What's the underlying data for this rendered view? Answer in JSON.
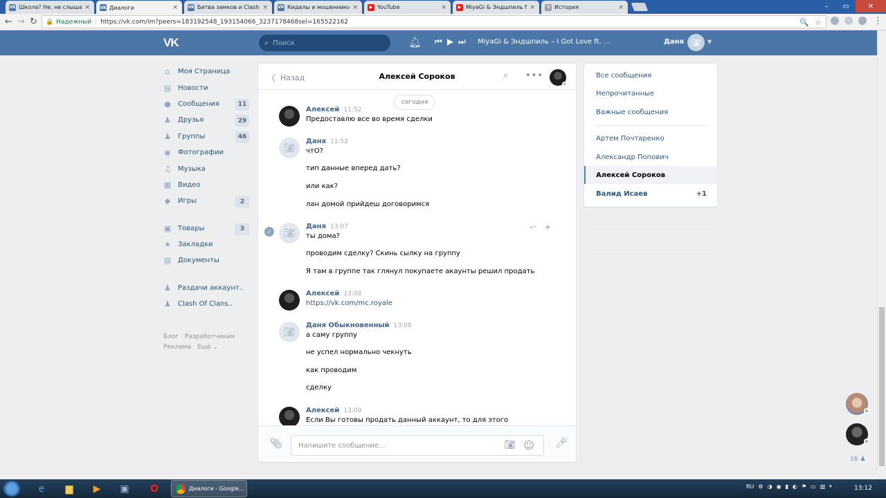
{
  "browser": {
    "tabs": [
      {
        "title": "Школа? Не, не слышали!",
        "fav": "VK",
        "color": "#4a76a8"
      },
      {
        "title": "Диалоги",
        "fav": "VK",
        "color": "#4a76a8"
      },
      {
        "title": "Битва замков и Clash Roya",
        "fav": "VK",
        "color": "#4a76a8"
      },
      {
        "title": "Кидалы и мошенники в vk",
        "fav": "VK",
        "color": "#4a76a8"
      },
      {
        "title": "YouTube",
        "fav": "▶",
        "color": "#e62117"
      },
      {
        "title": "MiyaGi & Эндшпиль ft. An",
        "fav": "▶",
        "color": "#e62117"
      },
      {
        "title": "История",
        "fav": "⟲",
        "color": "#9aa0a6"
      }
    ],
    "close_glyph": "×",
    "secure_label": "Надежный",
    "url": "https://vk.com/im?peers=183192548_193154066_3237178468sel=165522162"
  },
  "header": {
    "logo": "VK",
    "search_placeholder": "Поиск",
    "track": "MiyaGi & Эндшпиль – I Got Love ft. ...",
    "user_name": "Даня"
  },
  "left_menu": {
    "items": [
      {
        "label": "Моя Страница",
        "icon": "⌂",
        "count": ""
      },
      {
        "label": "Новости",
        "icon": "▤",
        "count": ""
      },
      {
        "label": "Сообщения",
        "icon": "●",
        "count": "11"
      },
      {
        "label": "Друзья",
        "icon": "♟",
        "count": "29"
      },
      {
        "label": "Группы",
        "icon": "♟",
        "count": "46"
      },
      {
        "label": "Фотографии",
        "icon": "◉",
        "count": ""
      },
      {
        "label": "Музыка",
        "icon": "♫",
        "count": ""
      },
      {
        "label": "Видео",
        "icon": "▦",
        "count": ""
      },
      {
        "label": "Игры",
        "icon": "◆",
        "count": "2"
      }
    ],
    "items2": [
      {
        "label": "Товары",
        "icon": "▣",
        "count": "3"
      },
      {
        "label": "Закладки",
        "icon": "★",
        "count": ""
      },
      {
        "label": "Документы",
        "icon": "▤",
        "count": ""
      }
    ],
    "items3": [
      {
        "label": "Раздачи аккаунт..",
        "icon": "♟",
        "count": ""
      },
      {
        "label": "Clash Of Clans..",
        "icon": "♟",
        "count": ""
      }
    ],
    "footer": [
      "Блог",
      "Разработчикам",
      "Реклама",
      "Ещё ⌄"
    ]
  },
  "chat": {
    "back_label": "Назад",
    "title": "Алексей Сороков",
    "date_pill": "сегодня",
    "messages": [
      {
        "author": "Алексей",
        "time": "11:52",
        "ava": "photo",
        "lines": [
          "Предоставлю все во время сделки"
        ]
      },
      {
        "author": "Даня",
        "time": "11:52",
        "ava": "cam",
        "lines": [
          "чтО?",
          "тип данные вперед дать?",
          "или как?",
          "лан домой прийдеш договоримся"
        ]
      },
      {
        "author": "Даня",
        "time": "13:07",
        "ava": "cam",
        "selected": true,
        "lines": [
          "ты дома?",
          "проводим сделку? Скинь сылку на группу",
          "Я там в группе так глянул покупаете акаунты решил продать"
        ]
      },
      {
        "author": "Алексей",
        "time": "13:08",
        "ava": "photo",
        "lines": [
          "https://vk.com/mc.royale"
        ],
        "link": true
      },
      {
        "author": "Даня Обыкновенный",
        "time": "13:08",
        "ava": "cam",
        "lines": [
          "а саму группу",
          "не успел нормально чекнуть",
          "как проводим",
          "сделку"
        ]
      },
      {
        "author": "Алексей",
        "time": "13:09",
        "ava": "photo",
        "lines": [
          "Если Вы готовы продать данный аккаунт, то для этого"
        ]
      }
    ],
    "compose_placeholder": "Напишите сообщение..."
  },
  "right_menu": {
    "items": [
      {
        "label": "Все сообщения"
      },
      {
        "label": "Непрочитанные"
      },
      {
        "label": "Важные сообщения"
      },
      {
        "label": "Артем Почтаренко"
      },
      {
        "label": "Александр Попович"
      },
      {
        "label": "Алексей Сороков"
      },
      {
        "label": "Валид Исаев",
        "badge": "+1"
      }
    ]
  },
  "friends_widget": {
    "count": "16 ♟"
  },
  "taskbar": {
    "chrome_title": "Диалоги - Google...",
    "lang": "RU",
    "time": "13:12"
  }
}
